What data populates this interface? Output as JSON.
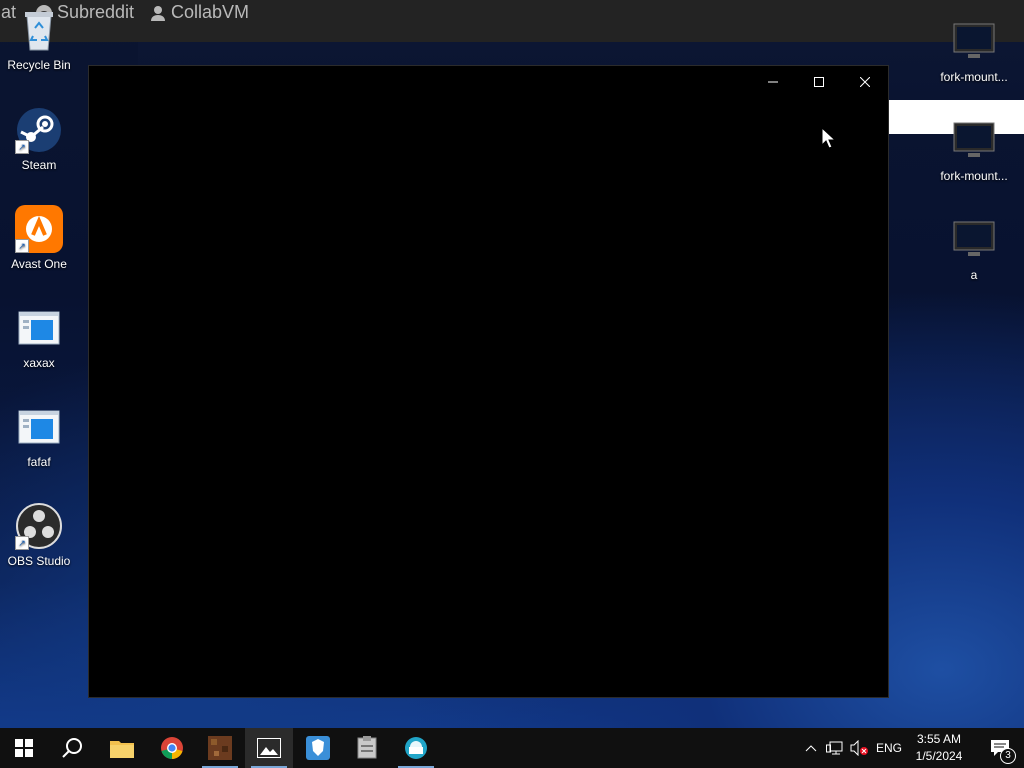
{
  "site_nav": {
    "chat_label": "Chat",
    "subreddit_label": "Subreddit",
    "collabvm_label": "CollabVM"
  },
  "desktop": {
    "left_icons": [
      {
        "label": "Recycle Bin",
        "icon": "recycle-bin-icon"
      },
      {
        "label": "Steam",
        "icon": "steam-icon"
      },
      {
        "label": "Avast One",
        "icon": "avast-icon"
      },
      {
        "label": "xaxax",
        "icon": "window-file-icon"
      },
      {
        "label": "fafaf",
        "icon": "window-file-icon"
      },
      {
        "label": "OBS Studio",
        "icon": "obs-icon"
      }
    ],
    "right_icons": [
      {
        "label": "fork-mount...",
        "icon": "monitor-icon"
      },
      {
        "label": "fork-mount...",
        "icon": "monitor-icon"
      },
      {
        "label": "a",
        "icon": "monitor-icon"
      }
    ]
  },
  "window": {
    "controls": [
      "minimize",
      "maximize",
      "close"
    ]
  },
  "taskbar": {
    "apps": [
      "start",
      "search",
      "file-explorer",
      "chrome",
      "minecraft",
      "photos",
      "brave",
      "archive",
      "network-app"
    ],
    "tray": {
      "language": "ENG",
      "time": "3:55 AM",
      "date": "1/5/2024",
      "notification_count": "3"
    }
  },
  "colors": {
    "taskbar": "#101010",
    "window_bg": "#000000",
    "accent": "#0078d4"
  }
}
